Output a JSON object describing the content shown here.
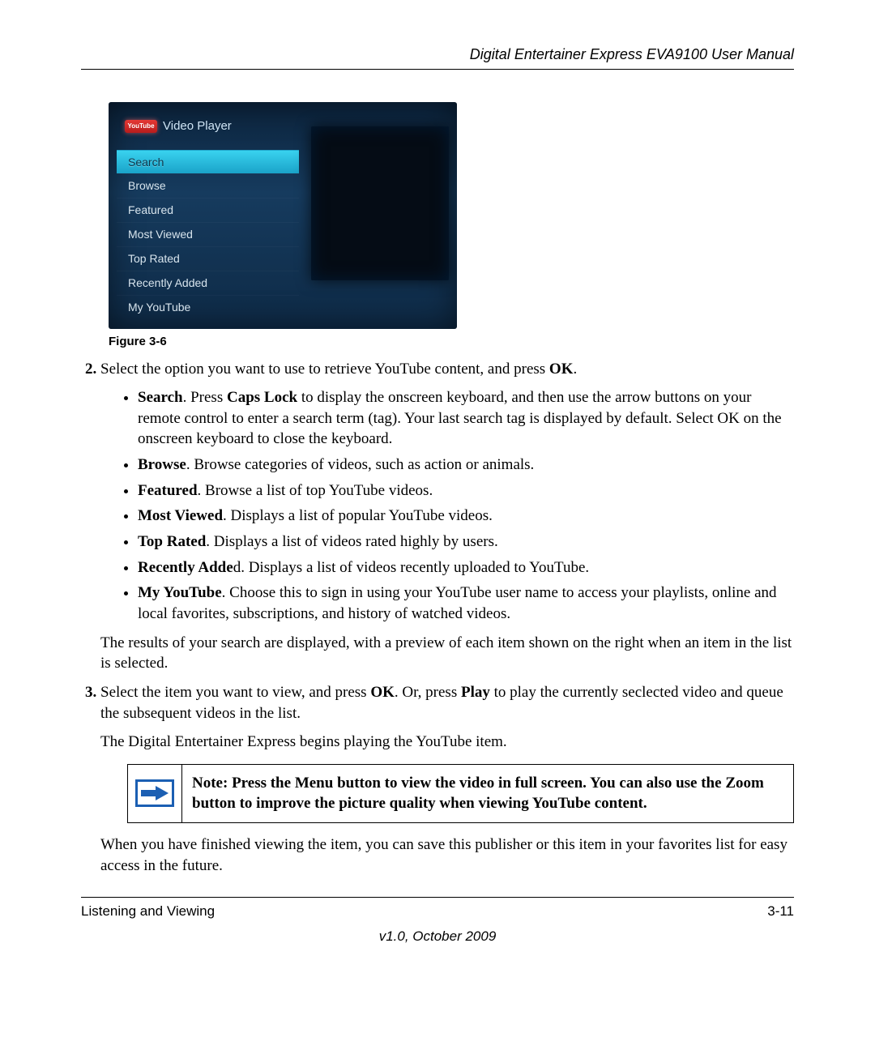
{
  "header": {
    "title": "Digital Entertainer Express EVA9100 User Manual"
  },
  "screenshot": {
    "logo_text": "YouTube",
    "app_title": "Video Player",
    "menu": [
      {
        "label": "Search",
        "selected": true
      },
      {
        "label": "Browse",
        "selected": false
      },
      {
        "label": "Featured",
        "selected": false
      },
      {
        "label": "Most Viewed",
        "selected": false
      },
      {
        "label": "Top Rated",
        "selected": false
      },
      {
        "label": "Recently Added",
        "selected": false
      },
      {
        "label": "My YouTube",
        "selected": false
      }
    ]
  },
  "figure_caption": "Figure 3-6",
  "steps": {
    "s2": {
      "intro_pre": "Select the option you want to use to retrieve YouTube content, and press ",
      "intro_bold": "OK",
      "intro_post": ".",
      "bullets": [
        {
          "b": "Search",
          "t": ". Press ",
          "b2": "Caps Lock",
          "t2": " to display the onscreen keyboard, and then use the arrow buttons on your remote control to enter a search term (tag). Your last search tag is displayed by default. Select OK on the onscreen keyboard to close the keyboard."
        },
        {
          "b": "Browse",
          "t": ". Browse categories of videos, such as action or animals."
        },
        {
          "b": "Featured",
          "t": ". Browse a list of top YouTube videos."
        },
        {
          "b": "Most Viewed",
          "t": ". Displays a list of popular YouTube videos."
        },
        {
          "b": "Top Rated",
          "t": ". Displays a list of videos rated highly by users."
        },
        {
          "b": "Recently Adde",
          "t": "d. Displays a list of videos recently uploaded to YouTube."
        },
        {
          "b": "My YouTube",
          "t": ". Choose this to sign in using your YouTube user name to access your playlists, online and local favorites, subscriptions, and history of watched videos."
        }
      ],
      "after": "The results of your search are displayed, with a preview of each item shown on the right when an item in the list is selected."
    },
    "s3": {
      "pre": "Select the item you want to view, and press ",
      "b1": "OK",
      "mid": ". Or, press ",
      "b2": "Play",
      "post": " to play the currently seclected video and queue the subsequent videos in the list.",
      "after1": "The Digital Entertainer Express begins playing the YouTube item.",
      "note_bold1": "Note:",
      "note_t1": " Press the ",
      "note_bold2": "Menu",
      "note_t2": " button to view the video in full screen. You can also use the ",
      "note_bold3": "Zoom",
      "note_t3": " button to improve the picture quality when viewing YouTube content.",
      "after2": "When you have finished viewing the item, you can save this publisher or this item in your favorites list for easy access in the future."
    }
  },
  "footer": {
    "section": "Listening and Viewing",
    "page": "3-11",
    "version": "v1.0, October 2009"
  }
}
